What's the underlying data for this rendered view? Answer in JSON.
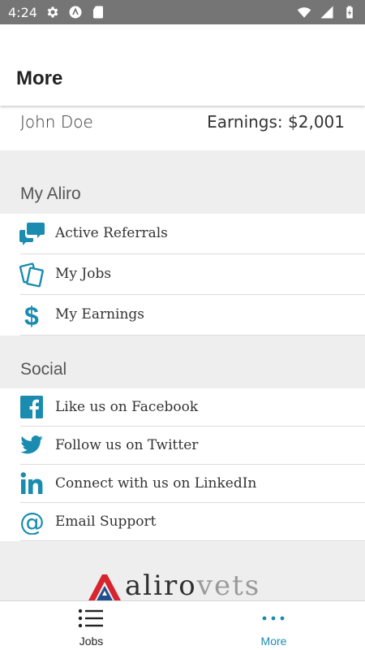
{
  "status_bar": {
    "time": "4:24",
    "left_icons": [
      "gear-icon",
      "app-a-icon",
      "sd-card-icon"
    ],
    "right_icons": [
      "wifi-icon",
      "signal-icon",
      "battery-charging-icon"
    ]
  },
  "header": {
    "title": "More"
  },
  "profile": {
    "name": "John Doe",
    "earnings": "Earnings: $2,001"
  },
  "sections": {
    "my_aliro": {
      "title": "My Aliro",
      "items": [
        {
          "label": "Active Referrals",
          "icon": "chat-bubbles-icon"
        },
        {
          "label": "My Jobs",
          "icon": "cards-icon"
        },
        {
          "label": "My Earnings",
          "icon": "dollar-icon"
        }
      ]
    },
    "social": {
      "title": "Social",
      "items": [
        {
          "label": "Like us on Facebook",
          "icon": "facebook-icon"
        },
        {
          "label": "Follow us on Twitter",
          "icon": "twitter-icon"
        },
        {
          "label": "Connect with us on LinkedIn",
          "icon": "linkedin-icon"
        },
        {
          "label": "Email Support",
          "icon": "at-sign-icon"
        }
      ]
    }
  },
  "logo": {
    "text_main": "aliro",
    "text_accent": "vets"
  },
  "tab_bar": {
    "tabs": [
      {
        "label": "Jobs",
        "icon": "list-icon",
        "active": false
      },
      {
        "label": "More",
        "icon": "more-dots-icon",
        "active": true
      }
    ]
  },
  "colors": {
    "accent": "#1a8cb0",
    "status_bar": "#757575",
    "section_background": "#eeeeee",
    "text_primary": "#333333",
    "logo_red": "#d6252f",
    "logo_blue": "#1f4f8c"
  }
}
